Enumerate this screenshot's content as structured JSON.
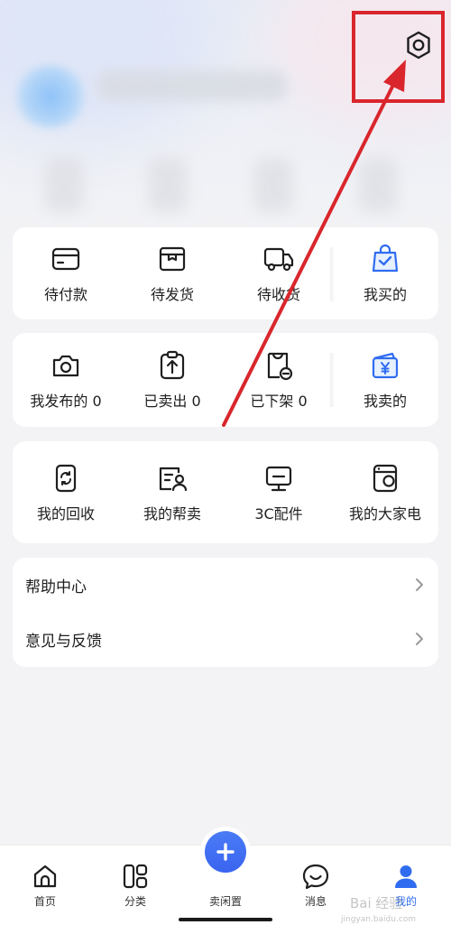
{
  "orders": {
    "items": [
      {
        "label": "待付款",
        "icon": "wallet-card-icon"
      },
      {
        "label": "待发货",
        "icon": "package-box-icon"
      },
      {
        "label": "待收货",
        "icon": "delivery-truck-icon"
      },
      {
        "label": "我买的",
        "icon": "shopping-bag-check-icon"
      }
    ]
  },
  "selling": {
    "items": [
      {
        "label": "我发布的 0",
        "icon": "camera-icon"
      },
      {
        "label": "已卖出 0",
        "icon": "clipboard-upload-icon"
      },
      {
        "label": "已下架 0",
        "icon": "shirt-tag-minus-icon"
      },
      {
        "label": "我卖的",
        "icon": "yen-wallet-icon"
      }
    ]
  },
  "services": {
    "items": [
      {
        "label": "我的回收",
        "icon": "recycle-phone-icon"
      },
      {
        "label": "我的帮卖",
        "icon": "seller-card-icon"
      },
      {
        "label": "3C配件",
        "icon": "monitor-icon"
      },
      {
        "label": "我的大家电",
        "icon": "washing-machine-icon"
      }
    ]
  },
  "menu": {
    "items": [
      {
        "label": "帮助中心"
      },
      {
        "label": "意见与反馈"
      }
    ]
  },
  "tabbar": {
    "tabs": [
      {
        "label": "首页",
        "icon": "home-icon"
      },
      {
        "label": "分类",
        "icon": "category-grid-icon"
      },
      {
        "label": "卖闲置",
        "icon": "plus-icon"
      },
      {
        "label": "消息",
        "icon": "chat-bubble-icon"
      },
      {
        "label": "我的",
        "icon": "user-profile-icon",
        "active": true
      }
    ]
  },
  "watermark": {
    "text": "Bai 经验",
    "sub": "jingyan.baidu.com"
  },
  "colors": {
    "accent": "#3a64f0",
    "highlight": "#d9262c",
    "active_blue": "#2f6cf0",
    "icon_dark": "#1f1f1f"
  }
}
